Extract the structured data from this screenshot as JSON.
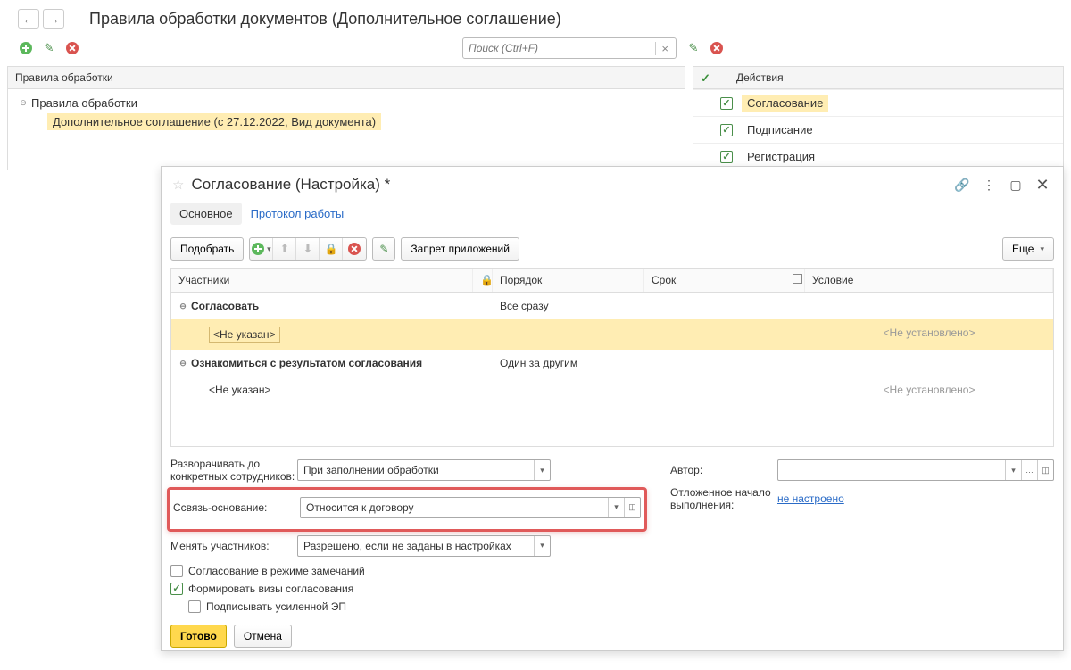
{
  "nav": {
    "back": "←",
    "forward": "→"
  },
  "page_title": "Правила обработки документов (Дополнительное соглашение)",
  "search": {
    "placeholder": "Поиск (Ctrl+F)"
  },
  "left_panel": {
    "header": "Правила обработки",
    "root": "Правила обработки",
    "child": "Дополнительное соглашение (с 27.12.2022, Вид документа)"
  },
  "right_panel": {
    "header": "Действия",
    "items": [
      {
        "label": "Согласование",
        "highlighted": true
      },
      {
        "label": "Подписание",
        "highlighted": false
      },
      {
        "label": "Регистрация",
        "highlighted": false
      }
    ]
  },
  "dialog": {
    "title": "Согласование (Настройка) *",
    "tabs": {
      "main": "Основное",
      "log": "Протокол работы"
    },
    "toolbar": {
      "select": "Подобрать",
      "ban": "Запрет приложений",
      "more": "Еще"
    },
    "table": {
      "headers": {
        "participants": "Участники",
        "order": "Порядок",
        "deadline": "Срок",
        "condition": "Условие"
      },
      "g1": {
        "title": "Согласовать",
        "order": "Все сразу",
        "p1": "<Не указан>",
        "cond": "<Не установлено>"
      },
      "g2": {
        "title": "Ознакомиться с результатом согласования",
        "order": "Один за другим",
        "p1": "<Не указан>",
        "cond": "<Не установлено>"
      }
    },
    "form": {
      "expand_label": "Разворачивать до конкретных сотрудников:",
      "expand_value": "При заполнении обработки",
      "link_label": "Ссвязь-основание:",
      "link_value": "Относится к договору",
      "change_label": "Менять участников:",
      "change_value": "Разрешено, если не заданы в настройках",
      "author_label": "Автор:",
      "author_value": "",
      "delayed_label": "Отложенное начало выполнения:",
      "delayed_link": "не настроено",
      "chk1": "Согласование в режиме замечаний",
      "chk2": "Формировать визы согласования",
      "chk3": "Подписывать усиленной ЭП"
    },
    "footer": {
      "ok": "Готово",
      "cancel": "Отмена"
    }
  }
}
